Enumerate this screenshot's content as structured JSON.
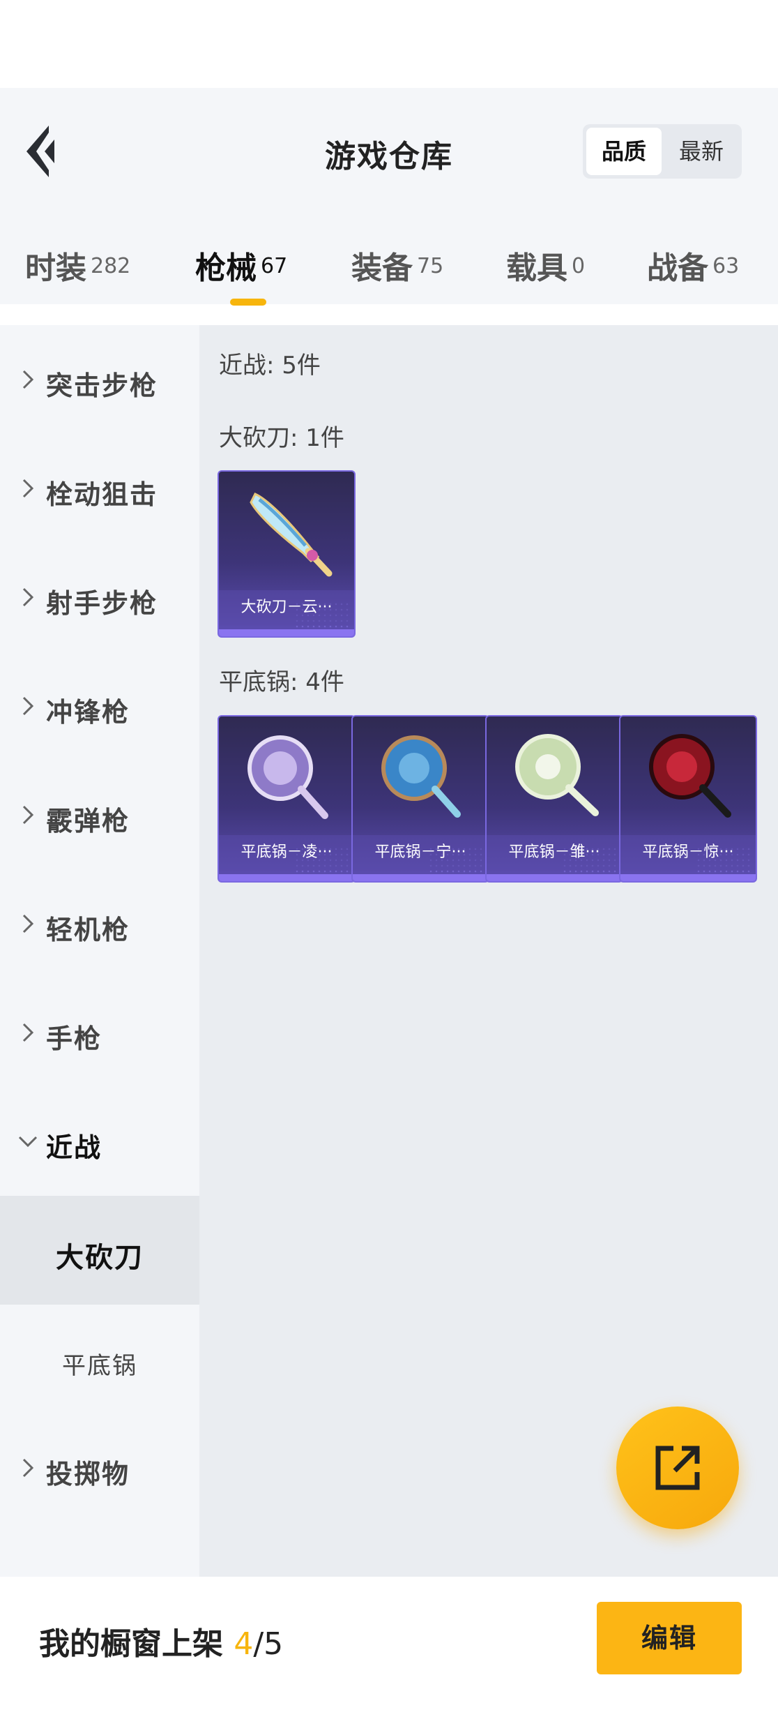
{
  "header": {
    "title": "游戏仓库",
    "sort_options": [
      "品质",
      "最新"
    ],
    "sort_selected": "品质"
  },
  "tabs": [
    {
      "label": "时装",
      "count": "282"
    },
    {
      "label": "枪械",
      "count": "67"
    },
    {
      "label": "装备",
      "count": "75"
    },
    {
      "label": "载具",
      "count": "0"
    },
    {
      "label": "战备",
      "count": "63"
    }
  ],
  "active_tab": "枪械",
  "sidebar": {
    "categories": [
      {
        "label": "突击步枪"
      },
      {
        "label": "栓动狙击"
      },
      {
        "label": "射手步枪"
      },
      {
        "label": "冲锋枪"
      },
      {
        "label": "霰弹枪"
      },
      {
        "label": "轻机枪"
      },
      {
        "label": "手枪"
      },
      {
        "label": "近战"
      },
      {
        "label": "投掷物"
      }
    ],
    "subcategories": [
      {
        "label": "大砍刀"
      },
      {
        "label": "平底锅"
      }
    ],
    "expanded": "近战",
    "selected": "大砍刀"
  },
  "content": {
    "group_title": "近战: 5件",
    "sections": [
      {
        "title": "大砍刀: 1件",
        "items": [
          {
            "label": "大砍刀－云···"
          }
        ]
      },
      {
        "title": "平底锅: 4件",
        "items": [
          {
            "label": "平底锅－凌···"
          },
          {
            "label": "平底锅－宁···"
          },
          {
            "label": "平底锅－雏···"
          },
          {
            "label": "平底锅－惊···"
          }
        ]
      }
    ]
  },
  "footer": {
    "showcase_label": "我的橱窗上架",
    "showcase_count": "4",
    "showcase_total": "/5",
    "edit_label": "编辑"
  },
  "colors": {
    "accent": "#f7b50d",
    "card_border": "#7a68e0",
    "card_bg": "#3d3478"
  },
  "icons": {
    "back": "back-arrow-icon",
    "fab": "share-external-icon",
    "collapsed": "chevron-right-icon",
    "expanded": "chevron-down-icon"
  }
}
